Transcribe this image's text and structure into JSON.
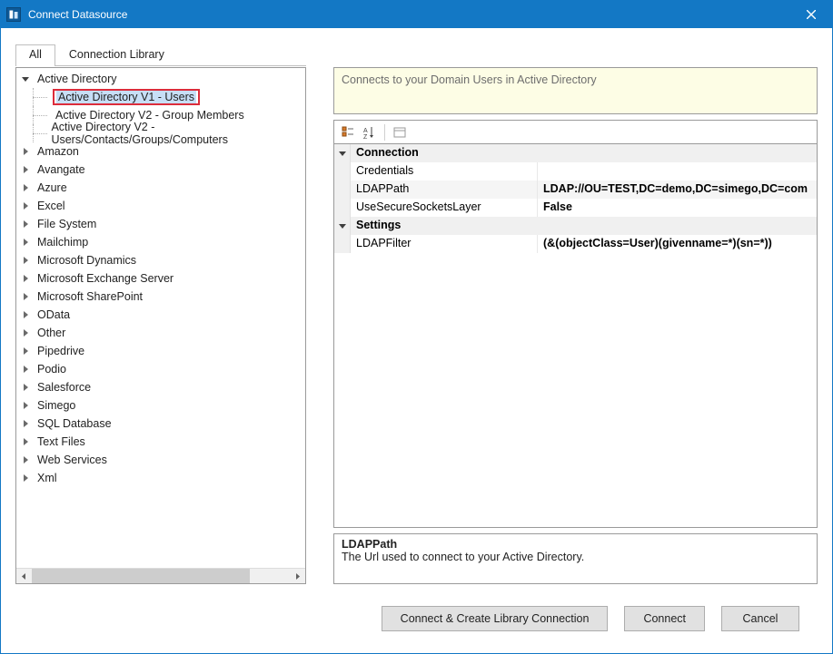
{
  "window": {
    "title": "Connect Datasource"
  },
  "tabs": {
    "all": "All",
    "library": "Connection Library"
  },
  "tree": {
    "expanded_category": "Active Directory",
    "expanded_children": [
      "Active Directory V1 - Users",
      "Active Directory V2 - Group Members",
      "Active Directory V2 - Users/Contacts/Groups/Computers"
    ],
    "selected_child_index": 0,
    "categories": [
      "Amazon",
      "Avangate",
      "Azure",
      "Excel",
      "File System",
      "Mailchimp",
      "Microsoft Dynamics",
      "Microsoft Exchange Server",
      "Microsoft SharePoint",
      "OData",
      "Other",
      "Pipedrive",
      "Podio",
      "Salesforce",
      "Simego",
      "SQL Database",
      "Text Files",
      "Web Services",
      "Xml"
    ]
  },
  "description": "Connects to your Domain Users in Active Directory",
  "property_grid": {
    "groups": [
      {
        "name": "Connection",
        "rows": [
          {
            "name": "Credentials",
            "value": ""
          },
          {
            "name": "LDAPPath",
            "value": "LDAP://OU=TEST,DC=demo,DC=simego,DC=com"
          },
          {
            "name": "UseSecureSocketsLayer",
            "value": "False"
          }
        ]
      },
      {
        "name": "Settings",
        "rows": [
          {
            "name": "LDAPFilter",
            "value": "(&(objectClass=User)(givenname=*)(sn=*))"
          }
        ]
      }
    ]
  },
  "help": {
    "title": "LDAPPath",
    "text": "The Url used to connect to your Active Directory."
  },
  "buttons": {
    "connect_create": "Connect & Create Library Connection",
    "connect": "Connect",
    "cancel": "Cancel"
  }
}
